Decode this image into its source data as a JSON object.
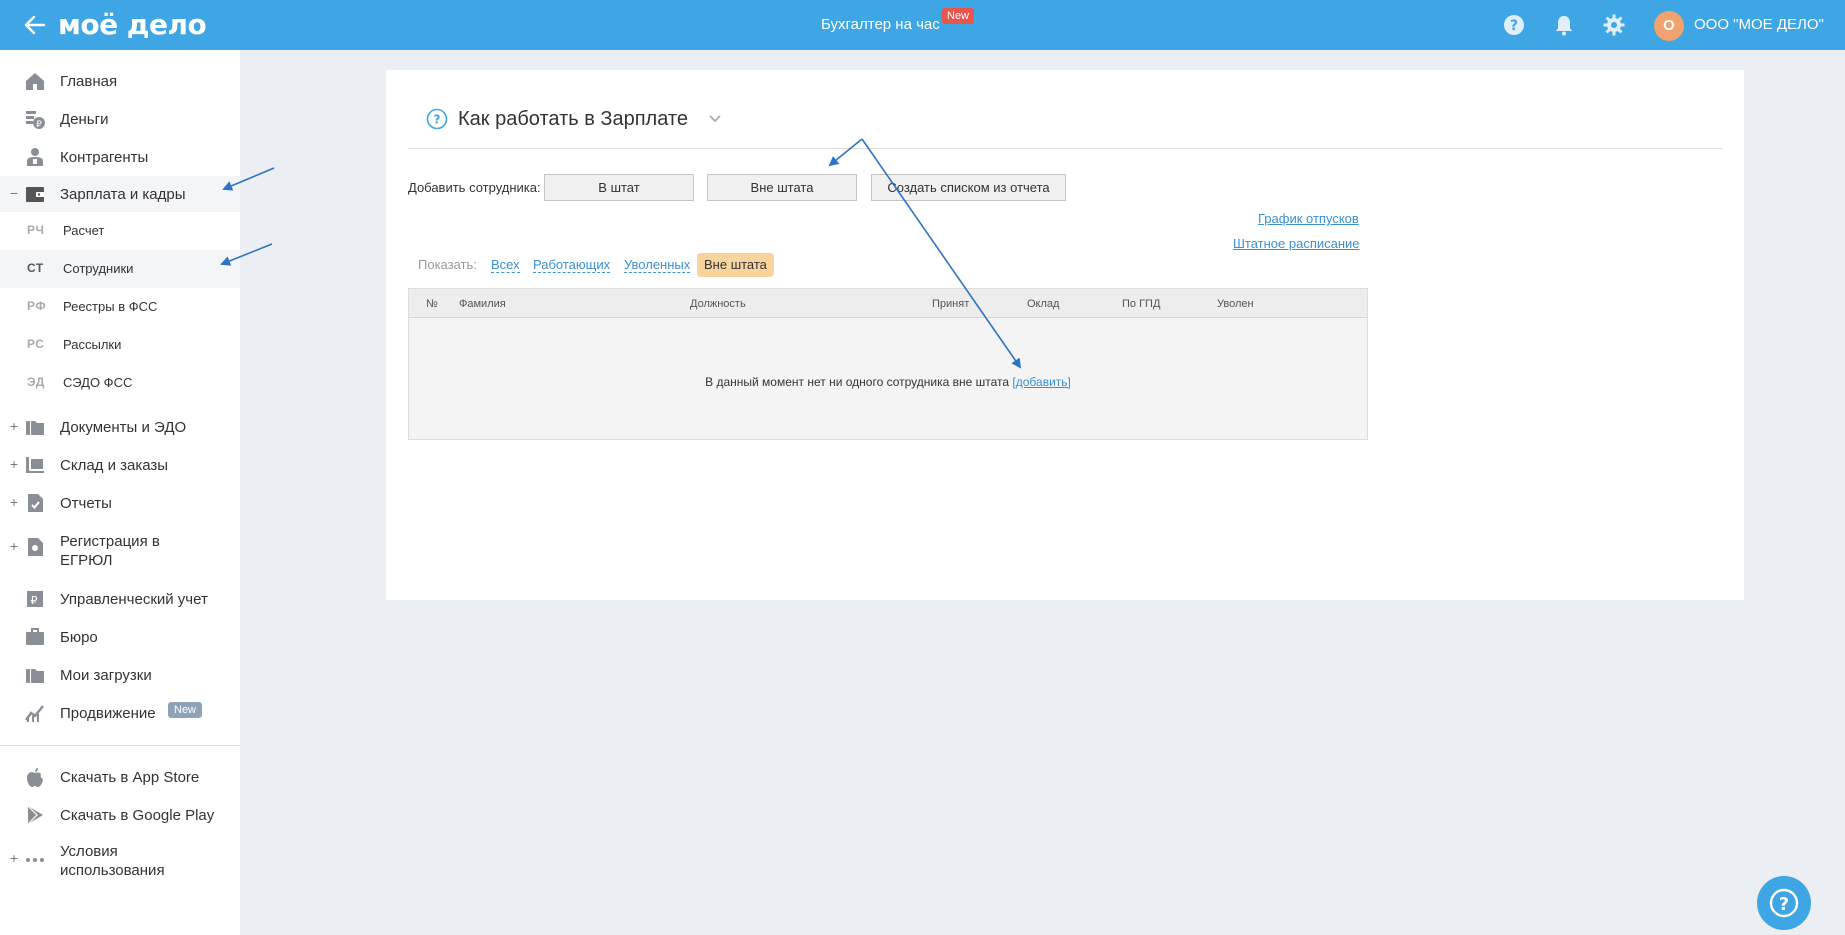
{
  "topbar": {
    "logo": "моё дело",
    "center_title": "Бухгалтер на час",
    "center_badge": "New",
    "avatar_letter": "О",
    "org_name": "ООО \"МОЕ ДЕЛО\""
  },
  "sidebar": {
    "items": [
      {
        "label": "Главная",
        "icon": "home-icon"
      },
      {
        "label": "Деньги",
        "icon": "money-icon"
      },
      {
        "label": "Контрагенты",
        "icon": "contractors-icon"
      },
      {
        "label": "Зарплата и кадры",
        "icon": "wallet-icon",
        "toggle": "−"
      },
      {
        "label": "Документы и ЭДО",
        "icon": "folder-icon",
        "toggle": "+"
      },
      {
        "label": "Склад и заказы",
        "icon": "warehouse-icon",
        "toggle": "+"
      },
      {
        "label": "Отчеты",
        "icon": "report-icon",
        "toggle": "+"
      },
      {
        "label": "Регистрация в ЕГРЮЛ",
        "icon": "registration-icon",
        "toggle": "+"
      },
      {
        "label": "Управленческий учет",
        "icon": "management-icon"
      },
      {
        "label": "Бюро",
        "icon": "briefcase-icon"
      },
      {
        "label": "Мои загрузки",
        "icon": "downloads-icon"
      },
      {
        "label": "Продвижение",
        "icon": "promotion-icon",
        "badge": "New"
      },
      {
        "label": "Скачать в App Store",
        "icon": "apple-icon"
      },
      {
        "label": "Скачать в Google Play",
        "icon": "google-play-icon"
      },
      {
        "label": "Условия использования",
        "icon": "more-icon",
        "toggle": "+"
      }
    ],
    "subitems": [
      {
        "abbr": "РЧ",
        "label": "Расчет"
      },
      {
        "abbr": "СТ",
        "label": "Сотрудники"
      },
      {
        "abbr": "РФ",
        "label": "Реестры в ФСС"
      },
      {
        "abbr": "РС",
        "label": "Рассылки"
      },
      {
        "abbr": "ЭД",
        "label": "СЭДО ФСС"
      }
    ]
  },
  "main": {
    "help_title": "Как работать в Зарплате",
    "add_label": "Добавить сотрудника:",
    "buttons": {
      "in_staff": "В штат",
      "out_staff": "Вне штата",
      "from_report": "Создать списком из отчета"
    },
    "links": {
      "vacation": "График отпусков",
      "staffing": "Штатное расписание"
    },
    "filter": {
      "label": "Показать:",
      "all": "Всех",
      "working": "Работающих",
      "fired": "Уволенных",
      "active": "Вне штата"
    },
    "table": {
      "columns": [
        "№",
        "Фамилия",
        "Должность",
        "Принят",
        "Оклад",
        "По ГПД",
        "Уволен"
      ],
      "empty_text": "В данный момент нет ни одного сотрудника вне штата",
      "empty_link": "[добавить]"
    }
  },
  "colors": {
    "topbar": "#3ea6e4",
    "link": "#3b8fd3",
    "active_filter": "#f7d39e",
    "annotation_arrow": "#2f73c4"
  }
}
